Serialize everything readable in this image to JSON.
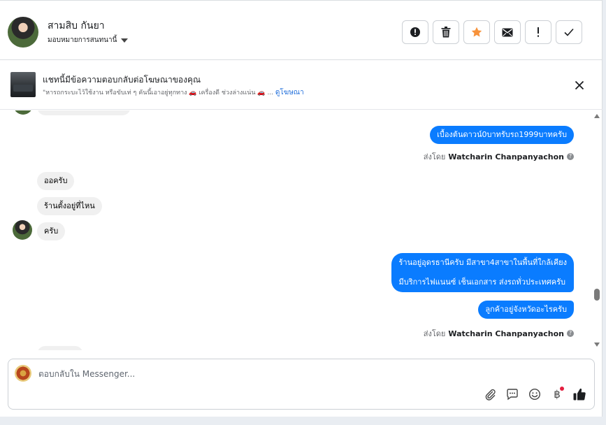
{
  "header": {
    "contact_name": "สามสิบ กันยา",
    "assign_label": "มอบหมายการสนทนานี้",
    "actions": [
      {
        "name": "report-spam-button",
        "icon": "alert-circle-icon"
      },
      {
        "name": "delete-button",
        "icon": "trash-icon"
      },
      {
        "name": "star-button",
        "icon": "star-icon"
      },
      {
        "name": "mark-unread-button",
        "icon": "envelope-icon"
      },
      {
        "name": "priority-button",
        "icon": "exclamation-icon"
      },
      {
        "name": "mark-done-button",
        "icon": "check-icon"
      }
    ]
  },
  "ad": {
    "title": "แชทนี้มีข้อความตอบกลับต่อโฆษณาของคุณ",
    "subtitle": "\"หารถกระบะไว้ใช้งาน หรือขับเท่ ๆ คันนี้เอาอยู่ทุกทาง 🚗 เครื่องดี ช่วงล่างแน่น 🚗 ...",
    "link": "ดูโฆษณา"
  },
  "messages": [
    {
      "dir": "out",
      "text": "เบื้องต้นดาวน์0บาทรับรถ1999บาทครับ"
    },
    {
      "type": "sent_by",
      "prefix": "ส่งโดย",
      "name": "Watcharin Chanpanyachon"
    },
    {
      "dir": "in",
      "text": "ออครับ"
    },
    {
      "dir": "in",
      "text": "ร้านตั้งอยู่ที่ไหน"
    },
    {
      "dir": "in",
      "text": "ครับ"
    },
    {
      "dir": "out",
      "text": "ร้านอยู่อุดรธานีครับ มีสาขา4สาขาในพื้นที่ใกล้เคียง"
    },
    {
      "dir": "out",
      "text": "มีบริการไฟแนนซ์ เช็นเอกสาร ส่งรถทั่วประเทศครับ"
    },
    {
      "dir": "out",
      "text": "ลูกค้าอยู่จังหวัดอะไรครับ"
    },
    {
      "type": "sent_by",
      "prefix": "ส่งโดย",
      "name": "Watcharin Chanpanyachon"
    }
  ],
  "composer": {
    "placeholder": "ตอบกลับใน Messenger...",
    "tools": [
      "paperclip-icon",
      "saved-reply-icon",
      "emoji-icon",
      "baht-icon",
      "like-icon"
    ],
    "baht_glyph": "฿"
  },
  "colors": {
    "outgoing": "#0a7cff",
    "incoming": "#f0f0f0",
    "link": "#216fdb",
    "star": "#f7923b"
  }
}
